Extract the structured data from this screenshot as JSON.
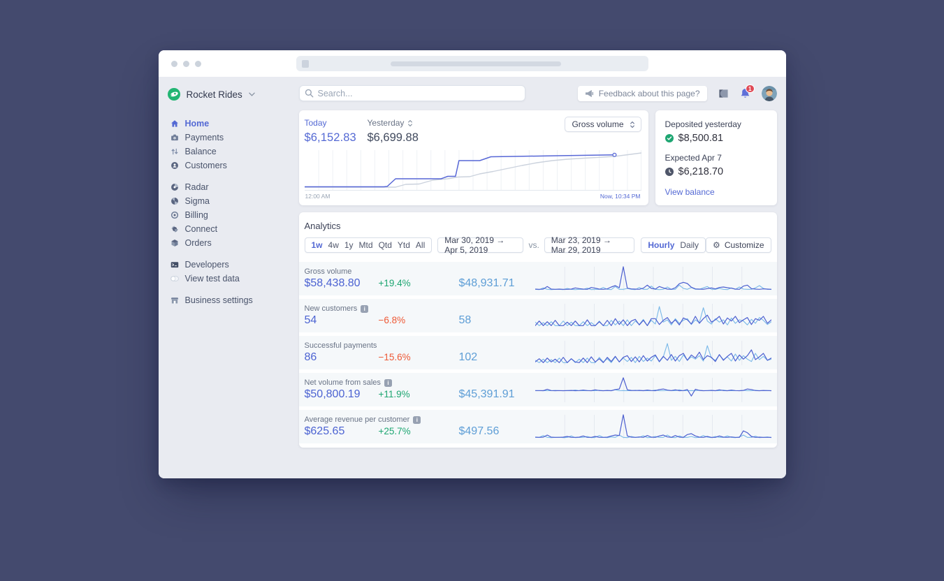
{
  "colors": {
    "accent": "#5469d4",
    "positive": "#1ea672",
    "negative": "#ee5936",
    "previous_period_blue": "#5e9ed6",
    "spark_current": "#4c5fd0",
    "spark_previous": "#79b8e8",
    "today_line": "#5767d6",
    "yesterday_line": "#cbd2dd",
    "logo_green": "#23b573",
    "badge_red": "#df4b57"
  },
  "topbar": {
    "search_placeholder": "Search...",
    "feedback_label": "Feedback about this page?",
    "notification_count": "1"
  },
  "sidebar": {
    "account_name": "Rocket Rides",
    "groups": [
      {
        "items": [
          {
            "icon": "home-icon",
            "label": "Home",
            "active": true
          },
          {
            "icon": "payments-icon",
            "label": "Payments",
            "active": false
          },
          {
            "icon": "balance-icon",
            "label": "Balance",
            "active": false
          },
          {
            "icon": "customers-icon",
            "label": "Customers",
            "active": false
          }
        ]
      },
      {
        "items": [
          {
            "icon": "radar-icon",
            "label": "Radar",
            "active": false
          },
          {
            "icon": "sigma-icon",
            "label": "Sigma",
            "active": false
          },
          {
            "icon": "billing-icon",
            "label": "Billing",
            "active": false
          },
          {
            "icon": "connect-icon",
            "label": "Connect",
            "active": false
          },
          {
            "icon": "orders-icon",
            "label": "Orders",
            "active": false
          }
        ]
      },
      {
        "items": [
          {
            "icon": "developers-icon",
            "label": "Developers",
            "active": false
          },
          {
            "icon": "test-data-toggle",
            "label": "View test data",
            "active": false
          }
        ]
      },
      {
        "items": [
          {
            "icon": "business-settings-icon",
            "label": "Business settings",
            "active": false
          }
        ]
      }
    ]
  },
  "today_card": {
    "today_label": "Today",
    "today_value": "$6,152.83",
    "yesterday_label": "Yesterday",
    "yesterday_value": "$6,699.88",
    "metric_select_value": "Gross volume",
    "axis_start": "12:00 AM",
    "axis_end": "Now, 10:34 PM"
  },
  "deposits_card": {
    "deposited_label": "Deposited yesterday",
    "deposited_value": "$8,500.81",
    "expected_label": "Expected Apr 7",
    "expected_value": "$6,218.70",
    "link_label": "View balance"
  },
  "analytics": {
    "title": "Analytics",
    "range_options": [
      "1w",
      "4w",
      "1y",
      "Mtd",
      "Qtd",
      "Ytd",
      "All"
    ],
    "active_range": "1w",
    "current_period": "Mar 30, 2019 →  Apr 5, 2019",
    "vs_label": "vs.",
    "previous_period": "Mar 23, 2019 → Mar 29, 2019",
    "granularity_options": [
      "Hourly",
      "Daily"
    ],
    "active_granularity": "Hourly",
    "customize_label": "Customize",
    "metrics": [
      {
        "label": "Gross volume",
        "info": false,
        "value": "$58,438.80",
        "delta": "+19.4%",
        "trend": "up",
        "previous": "$48,931.71"
      },
      {
        "label": "New customers",
        "info": true,
        "value": "54",
        "delta": "−6.8%",
        "trend": "down",
        "previous": "58"
      },
      {
        "label": "Successful payments",
        "info": false,
        "value": "86",
        "delta": "−15.6%",
        "trend": "down",
        "previous": "102"
      },
      {
        "label": "Net volume from sales",
        "info": true,
        "value": "$50,800.19",
        "delta": "+11.9%",
        "trend": "up",
        "previous": "$45,391.91"
      },
      {
        "label": "Average revenue per customer",
        "info": true,
        "value": "$625.65",
        "delta": "+25.7%",
        "trend": "up",
        "previous": "$497.56"
      }
    ]
  },
  "chart_data": [
    {
      "type": "line",
      "title": "Gross volume — Today vs Yesterday",
      "x_axis": {
        "start": "12:00 AM",
        "end": "Now, 10:34 PM",
        "gridline_columns": 24
      },
      "series": [
        {
          "name": "Today",
          "total": "$6,152.83",
          "points": [
            [
              0,
              0.03
            ],
            [
              0.235,
              0.03
            ],
            [
              0.245,
              0.04
            ],
            [
              0.27,
              0.26
            ],
            [
              0.405,
              0.26
            ],
            [
              0.425,
              0.33
            ],
            [
              0.448,
              0.33
            ],
            [
              0.458,
              0.78
            ],
            [
              0.52,
              0.78
            ],
            [
              0.553,
              0.89
            ],
            [
              0.62,
              0.9
            ],
            [
              0.75,
              0.92
            ],
            [
              0.92,
              0.945
            ]
          ],
          "endpoint_marker": [
            0.92,
            0.945
          ]
        },
        {
          "name": "Yesterday",
          "total": "$6,699.88",
          "points": [
            [
              0,
              0.02
            ],
            [
              0.27,
              0.02
            ],
            [
              0.3,
              0.1
            ],
            [
              0.34,
              0.11
            ],
            [
              0.38,
              0.22
            ],
            [
              0.425,
              0.26
            ],
            [
              0.455,
              0.31
            ],
            [
              0.49,
              0.32
            ],
            [
              0.52,
              0.4
            ],
            [
              0.56,
              0.47
            ],
            [
              0.6,
              0.55
            ],
            [
              0.645,
              0.64
            ],
            [
              0.69,
              0.72
            ],
            [
              0.735,
              0.78
            ],
            [
              0.78,
              0.82
            ],
            [
              0.83,
              0.85
            ],
            [
              0.875,
              0.875
            ],
            [
              0.92,
              0.9
            ],
            [
              0.96,
              0.95
            ],
            [
              1,
              1
            ]
          ]
        }
      ]
    },
    {
      "type": "sparklines",
      "note": "normalized hourly values 0-100, current period (1w) vs previous period",
      "rows": [
        {
          "name": "Gross volume",
          "baseline": 0.93,
          "current": [
            4,
            3,
            4,
            15,
            4,
            3,
            4,
            3,
            3,
            4,
            9,
            6,
            4,
            3,
            11,
            8,
            4,
            3,
            5,
            13,
            19,
            10,
            100,
            8,
            5,
            4,
            3,
            8,
            21,
            7,
            4,
            15,
            9,
            4,
            3,
            10,
            27,
            33,
            28,
            12,
            5,
            4,
            3,
            6,
            9,
            5,
            11,
            13,
            10,
            8,
            4,
            3,
            17,
            21,
            6,
            4,
            3,
            5,
            4,
            3
          ],
          "previous": [
            3,
            2,
            9,
            3,
            2,
            3,
            3,
            2,
            7,
            3,
            2,
            3,
            3,
            8,
            2,
            3,
            3,
            11,
            3,
            2,
            15,
            3,
            3,
            7,
            3,
            2,
            11,
            3,
            3,
            17,
            3,
            2,
            3,
            13,
            3,
            3,
            21,
            7,
            3,
            11,
            3,
            3,
            9,
            15,
            3,
            3,
            7,
            3,
            2,
            9,
            3,
            13,
            4,
            3,
            3,
            9,
            19,
            7,
            3,
            3
          ]
        },
        {
          "name": "New customers",
          "baseline": 0.93,
          "current": [
            6,
            26,
            6,
            23,
            6,
            29,
            6,
            6,
            21,
            6,
            26,
            6,
            6,
            31,
            6,
            6,
            23,
            6,
            29,
            6,
            36,
            11,
            31,
            6,
            26,
            33,
            9,
            29,
            6,
            36,
            36,
            11,
            29,
            41,
            16,
            31,
            9,
            39,
            31,
            13,
            46,
            16,
            36,
            51,
            21,
            31,
            46,
            13,
            39,
            26,
            46,
            19,
            31,
            41,
            11,
            36,
            29,
            46,
            16,
            31
          ],
          "previous": [
            21,
            6,
            19,
            6,
            23,
            6,
            6,
            26,
            6,
            21,
            6,
            6,
            23,
            6,
            19,
            6,
            26,
            6,
            6,
            29,
            9,
            26,
            6,
            31,
            6,
            26,
            11,
            33,
            6,
            29,
            13,
            88,
            21,
            31,
            9,
            36,
            16,
            29,
            36,
            11,
            31,
            19,
            83,
            26,
            13,
            36,
            21,
            31,
            9,
            39,
            16,
            31,
            26,
            9,
            33,
            16,
            41,
            29,
            11,
            23
          ]
        },
        {
          "name": "Successful payments",
          "baseline": 0.93,
          "current": [
            9,
            23,
            6,
            26,
            9,
            21,
            6,
            29,
            6,
            23,
            9,
            6,
            26,
            6,
            31,
            9,
            23,
            6,
            29,
            11,
            33,
            9,
            29,
            36,
            11,
            31,
            9,
            36,
            13,
            29,
            39,
            11,
            33,
            16,
            41,
            13,
            36,
            46,
            16,
            39,
            26,
            51,
            19,
            36,
            29,
            11,
            41,
            16,
            33,
            46,
            13,
            39,
            21,
            36,
            61,
            19,
            31,
            46,
            16,
            26
          ],
          "previous": [
            16,
            6,
            21,
            6,
            19,
            6,
            26,
            6,
            6,
            23,
            6,
            21,
            6,
            26,
            6,
            6,
            29,
            9,
            23,
            6,
            31,
            9,
            26,
            11,
            29,
            6,
            33,
            11,
            26,
            13,
            36,
            9,
            31,
            88,
            16,
            33,
            11,
            39,
            16,
            31,
            21,
            36,
            13,
            79,
            26,
            16,
            39,
            19,
            31,
            13,
            43,
            16,
            36,
            21,
            11,
            46,
            19,
            33,
            16,
            21
          ]
        },
        {
          "name": "Net volume from sales",
          "baseline": 0.55,
          "current": [
            3,
            3,
            2,
            13,
            3,
            2,
            3,
            2,
            3,
            4,
            2,
            3,
            7,
            3,
            2,
            9,
            3,
            2,
            4,
            2,
            11,
            15,
            100,
            9,
            4,
            3,
            5,
            2,
            7,
            3,
            2,
            11,
            15,
            7,
            3,
            9,
            2,
            3,
            11,
            -38,
            13,
            4,
            2,
            3,
            5,
            2,
            9,
            3,
            2,
            7,
            3,
            2,
            4,
            15,
            11,
            3,
            2,
            4,
            3,
            2
          ],
          "previous": [
            2,
            2,
            3,
            2,
            2,
            5,
            2,
            2,
            3,
            2,
            7,
            2,
            2,
            3,
            2,
            2,
            6,
            2,
            2,
            3,
            9,
            2,
            3,
            2,
            2,
            6,
            2,
            3,
            2,
            2,
            7,
            2,
            2,
            5,
            2,
            2,
            9,
            2,
            2,
            3,
            2,
            6,
            2,
            2,
            3,
            2,
            2,
            7,
            2,
            3,
            2,
            2,
            5,
            2,
            2,
            6,
            2,
            2,
            3,
            2
          ]
        },
        {
          "name": "Average revenue per customer",
          "baseline": 0.93,
          "current": [
            4,
            3,
            4,
            13,
            4,
            3,
            3,
            4,
            7,
            3,
            3,
            4,
            9,
            3,
            3,
            7,
            3,
            3,
            4,
            9,
            13,
            11,
            100,
            9,
            4,
            3,
            5,
            3,
            11,
            4,
            3,
            9,
            13,
            5,
            3,
            11,
            4,
            3,
            15,
            19,
            9,
            4,
            3,
            7,
            3,
            3,
            9,
            4,
            3,
            5,
            3,
            3,
            31,
            23,
            7,
            3,
            4,
            3,
            3,
            3
          ],
          "previous": [
            3,
            3,
            11,
            3,
            2,
            3,
            4,
            2,
            3,
            9,
            2,
            3,
            3,
            7,
            2,
            3,
            11,
            3,
            2,
            5,
            3,
            13,
            3,
            2,
            7,
            3,
            3,
            10,
            2,
            3,
            7,
            3,
            3,
            13,
            3,
            2,
            9,
            3,
            3,
            7,
            2,
            3,
            11,
            4,
            2,
            7,
            3,
            3,
            9,
            3,
            2,
            5,
            13,
            3,
            3,
            8,
            2,
            3,
            5,
            2
          ]
        }
      ]
    }
  ]
}
